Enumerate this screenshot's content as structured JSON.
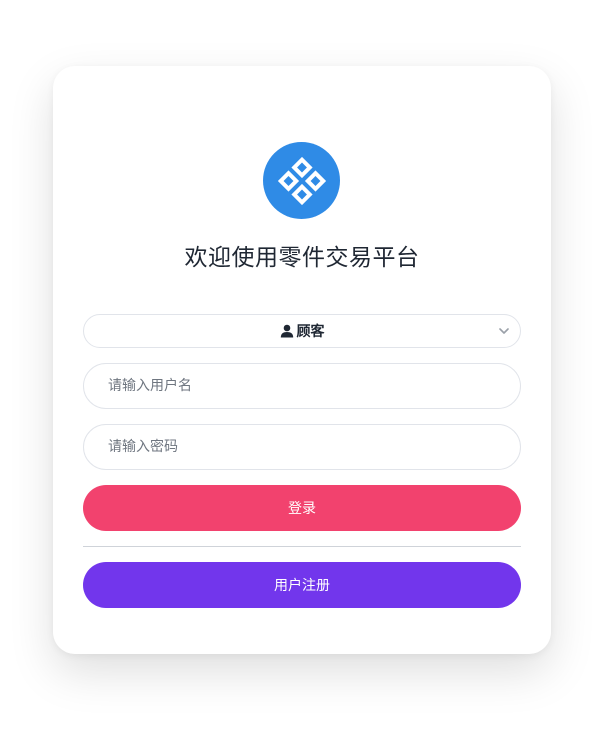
{
  "platform": {
    "title": "欢迎使用零件交易平台",
    "logo_icon": "diamond-grid-logo",
    "logo_color": "#2f8be6"
  },
  "role_select": {
    "icon": "user-icon",
    "selected": "顾客"
  },
  "form": {
    "username_placeholder": "请输入用户名",
    "password_placeholder": "请输入密码"
  },
  "actions": {
    "login_label": "登录",
    "login_color": "#f2426e",
    "register_label": "用户注册",
    "register_color": "#7236ec"
  }
}
